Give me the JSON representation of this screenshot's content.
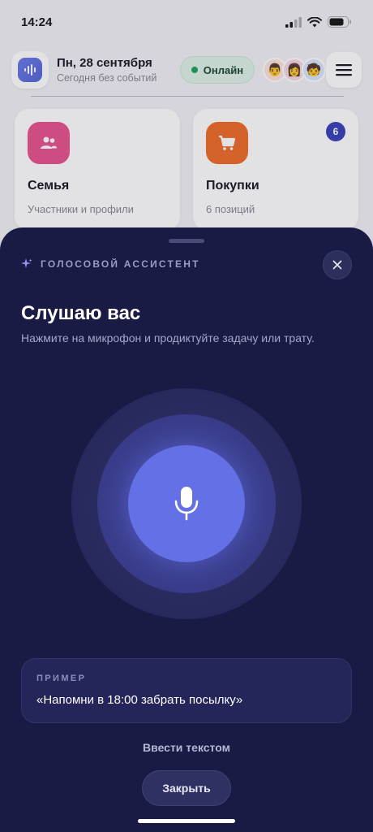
{
  "status_bar": {
    "time": "14:24",
    "icons": [
      "signal-icon",
      "wifi-icon",
      "battery-icon"
    ]
  },
  "header": {
    "date": "Пн, 28 сентября",
    "subtitle": "Сегодня без событий",
    "status_label": "Онлайн",
    "status_color": "#20a35a",
    "avatars": [
      "👨",
      "👩",
      "🧒"
    ]
  },
  "cards": [
    {
      "title": "Семья",
      "subtitle": "Участники и профили",
      "icon": "people-icon",
      "color": "#e7568f"
    },
    {
      "title": "Покупки",
      "subtitle": "6 позиций",
      "icon": "cart-icon",
      "color": "#ee6f2c",
      "badge": "6"
    }
  ],
  "sheet": {
    "section_label": "ГОЛОСОВОЙ АССИСТЕНТ",
    "title": "Слушаю вас",
    "description": "Нажмите на микрофон и продиктуйте задачу или трату.",
    "example_label": "ПРИМЕР",
    "example_text": "«Напомни в 18:00 забрать посылку»",
    "text_input_link": "Ввести текстом",
    "close_button": "Закрыть",
    "accent_color": "#6470e6",
    "background_color": "#1a1b45"
  }
}
